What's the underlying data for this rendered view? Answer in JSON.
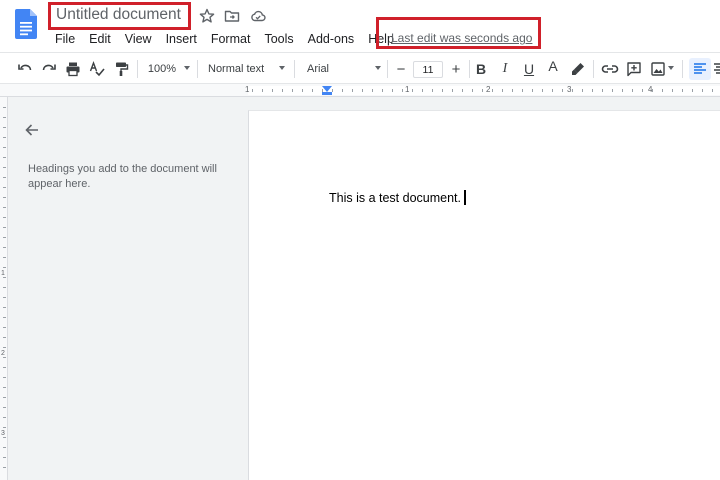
{
  "header": {
    "doc_title": "Untitled document",
    "last_edit": "Last edit was seconds ago",
    "star_icon": "star-icon",
    "move_icon": "folder-move-icon",
    "status_icon": "cloud-saved-icon"
  },
  "menu": {
    "items": [
      "File",
      "Edit",
      "View",
      "Insert",
      "Format",
      "Tools",
      "Add-ons",
      "Help"
    ]
  },
  "toolbar": {
    "zoom": "100%",
    "style": "Normal text",
    "font": "Arial",
    "font_size": "11",
    "decrease_size": "−",
    "increase_size": "+",
    "bold": "B",
    "italic": "I",
    "underline": "U",
    "text_color": "A"
  },
  "ruler": {
    "labels": [
      "1",
      "1",
      "2",
      "3",
      "4"
    ]
  },
  "vertical_ruler": {
    "labels": [
      "1",
      "2",
      "3"
    ]
  },
  "outline": {
    "hint": "Headings you add to the document will appear here."
  },
  "document": {
    "body_text": "This is a test document."
  },
  "colors": {
    "highlight_box": "#d0202a",
    "docs_blue": "#4285f4",
    "page_bg": "#ffffff",
    "app_bg": "#f1f3f4"
  }
}
